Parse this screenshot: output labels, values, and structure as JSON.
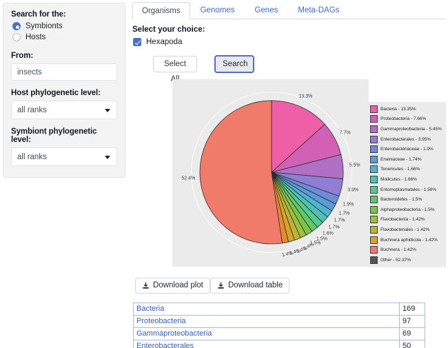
{
  "sidebar": {
    "search_for_label": "Search for the:",
    "radios": [
      {
        "label": "Symbionts",
        "checked": true
      },
      {
        "label": "Hosts",
        "checked": false
      }
    ],
    "from_label": "From:",
    "from_value": "insects",
    "host_level_label": "Host phylogenetic level:",
    "host_level_value": "all ranks",
    "symbiont_level_label": "Symbiont phylogenetic level:",
    "symbiont_level_value": "all ranks"
  },
  "tabs": [
    {
      "label": "Organisms",
      "active": true
    },
    {
      "label": "Genomes",
      "active": false
    },
    {
      "label": "Genes",
      "active": false
    },
    {
      "label": "Meta-DAGs",
      "active": false
    }
  ],
  "choice": {
    "title": "Select your choice:",
    "checkbox_label": "Hexapoda",
    "checkbox_checked": true,
    "select_all_label": "Select All",
    "search_label": "Search"
  },
  "actions": {
    "download_plot_label": "Download plot",
    "download_table_label": "Download table"
  },
  "chart_data": {
    "type": "pie",
    "title": "",
    "legend_position": "right",
    "labels": [
      "Bacteria",
      "Proteobacteria",
      "Gammaproteobacteria",
      "Enterobacterales",
      "Enterobacteriaceae",
      "Erwiniaceae",
      "Tenericutes",
      "Mollicutes",
      "Entomoplasmatales",
      "Bacteroidetes",
      "Alphaproteobacteria",
      "Flavobacteriia",
      "Flavobacteriales",
      "Buchnera aphidicola",
      "Buchnera",
      "Other"
    ],
    "values": [
      13.35,
      7.66,
      5.45,
      3.95,
      1.9,
      1.74,
      1.66,
      1.66,
      1.58,
      1.5,
      1.5,
      1.42,
      1.42,
      1.42,
      1.42,
      52.37
    ],
    "slice_labels": [
      "13.3%",
      "7.7%",
      "5.5%",
      "3.9%",
      "1.9%",
      "1.7%",
      "1.7%",
      "1.7%",
      "1.6%",
      "1.5%",
      "1.5%",
      "1.4%",
      "1.4%",
      "1.4%",
      "1.4%",
      "52.4%"
    ],
    "colors": [
      "#ee5fa7",
      "#d261b5",
      "#b070c6",
      "#8f7ed2",
      "#6f8ad8",
      "#5b9bd8",
      "#50b3cf",
      "#4dc2b4",
      "#55c98e",
      "#62c766",
      "#7cc348",
      "#a0bf3c",
      "#bdb435",
      "#d9a22e",
      "#e8882c",
      "#f07b6a",
      "#555555"
    ],
    "legend_entries": [
      {
        "label": "Bacteria - 13.35%",
        "color": "#ee5fa7"
      },
      {
        "label": "Proteobacteria - 7.66%",
        "color": "#d261b5"
      },
      {
        "label": "Gammaproteobacteria - 5.45%",
        "color": "#b070c6"
      },
      {
        "label": "Enterobacterales - 3.95%",
        "color": "#8f7ed2"
      },
      {
        "label": "Enterobacteriaceae - 1.9%",
        "color": "#6f8ad8"
      },
      {
        "label": "Erwiniaceae - 1.74%",
        "color": "#5b9bd8"
      },
      {
        "label": "Tenericutes - 1.66%",
        "color": "#50b3cf"
      },
      {
        "label": "Mollicutes - 1.66%",
        "color": "#4dc2b4"
      },
      {
        "label": "Entomoplasmatales - 1.58%",
        "color": "#55c98e"
      },
      {
        "label": "Bacteroidetes - 1.5%",
        "color": "#62c766"
      },
      {
        "label": "Alphaproteobacteria - 1.5%",
        "color": "#7cc348"
      },
      {
        "label": "Flavobacteriia - 1.42%",
        "color": "#a0bf3c"
      },
      {
        "label": "Flavobacteriales - 1.42%",
        "color": "#bdb435"
      },
      {
        "label": "Buchnera aphidicola - 1.42%",
        "color": "#d9a22e"
      },
      {
        "label": "Buchnera - 1.42%",
        "color": "#f07b6a"
      },
      {
        "label": "Other - 52.37%",
        "color": "#555555"
      }
    ]
  },
  "table": {
    "rows": [
      {
        "name": "Bacteria",
        "count": "169"
      },
      {
        "name": "Proteobacteria",
        "count": "97"
      },
      {
        "name": "Gammaproteobacteria",
        "count": "69"
      },
      {
        "name": "Enterobacterales",
        "count": "50"
      }
    ]
  }
}
